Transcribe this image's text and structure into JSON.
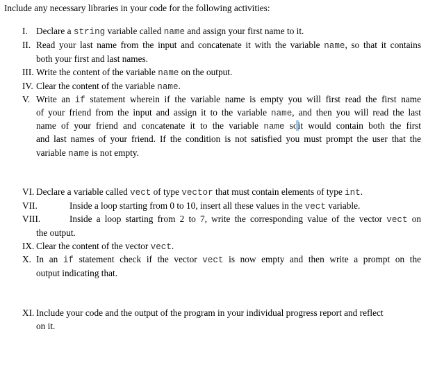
{
  "intro": "Include any necessary libraries in your code for the following activities:",
  "items": [
    {
      "numeral": "I.",
      "lines": [
        [
          {
            "t": "Declare a "
          },
          {
            "c": "string"
          },
          {
            "t": " variable called "
          },
          {
            "c": "name"
          },
          {
            "t": " and assign your first name to it."
          }
        ]
      ]
    },
    {
      "numeral": "II.",
      "lines": [
        [
          {
            "t": "Read your last name from the input and concatenate it with the variable "
          },
          {
            "c": "name"
          },
          {
            "t": ", so that it contains"
          }
        ],
        [
          {
            "t": "both your first and last names."
          }
        ]
      ]
    },
    {
      "numeral": "III.",
      "lines": [
        [
          {
            "t": "Write the content of the variable "
          },
          {
            "c": "name"
          },
          {
            "t": " on the output."
          }
        ]
      ]
    },
    {
      "numeral": "IV.",
      "lines": [
        [
          {
            "t": "Clear the content of the variable "
          },
          {
            "c": "name"
          },
          {
            "t": "."
          }
        ]
      ]
    },
    {
      "numeral": "V.",
      "lines": [
        [
          {
            "t": "Write an "
          },
          {
            "c": "if"
          },
          {
            "t": " statement wherein if the variable name is empty you will first read the first name"
          }
        ],
        [
          {
            "t": "of your friend from the input and assign it to the variable "
          },
          {
            "c": "name"
          },
          {
            "t": ", and then you will read the last"
          }
        ],
        [
          {
            "t": "name of your friend and concatenate it to the variable "
          },
          {
            "c": "name"
          },
          {
            "t": " so"
          },
          {
            "caret": true
          },
          {
            "t": "it would contain both the first"
          }
        ],
        [
          {
            "t": "and last names of your friend. If the condition is not satisfied you must prompt the user that the"
          }
        ],
        [
          {
            "t": "variable "
          },
          {
            "c": "name"
          },
          {
            "t": " is not empty."
          }
        ]
      ]
    },
    {
      "numeral": "VI.",
      "lines": [
        [
          {
            "t": "Declare a variable called "
          },
          {
            "c": "vect"
          },
          {
            "t": " of type "
          },
          {
            "c": "vector"
          },
          {
            "t": " that must contain elements of type "
          },
          {
            "c": "int"
          },
          {
            "t": "."
          }
        ]
      ]
    },
    {
      "numeral": "VII.",
      "lines": [
        [
          {
            "t": "Inside a loop starting from 0 to 10, insert all these values  in the "
          },
          {
            "c": "vect"
          },
          {
            "t": " variable."
          }
        ]
      ]
    },
    {
      "numeral": "VIII.",
      "lines": [
        [
          {
            "t": "Inside a loop starting from 2 to 7, write the corresponding value of the vector "
          },
          {
            "c": "vect"
          },
          {
            "t": " on"
          }
        ],
        [
          {
            "t": "the output."
          }
        ]
      ]
    },
    {
      "numeral": "IX.",
      "lines": [
        [
          {
            "t": "Clear the content of the vector "
          },
          {
            "c": "vect"
          },
          {
            "t": "."
          }
        ]
      ]
    },
    {
      "numeral": "X.",
      "lines": [
        [
          {
            "t": "In an "
          },
          {
            "c": "if"
          },
          {
            "t": " statement check if the vector "
          },
          {
            "c": "vect"
          },
          {
            "t": " is now empty and then write a prompt on the"
          }
        ],
        [
          {
            "t": "output indicating that."
          }
        ]
      ]
    },
    {
      "numeral": "XI.",
      "lines": [
        [
          {
            "t": "Include your code and the output of the program in your individual progress report and reflect"
          }
        ],
        [
          {
            "t": "on it."
          }
        ]
      ]
    }
  ]
}
